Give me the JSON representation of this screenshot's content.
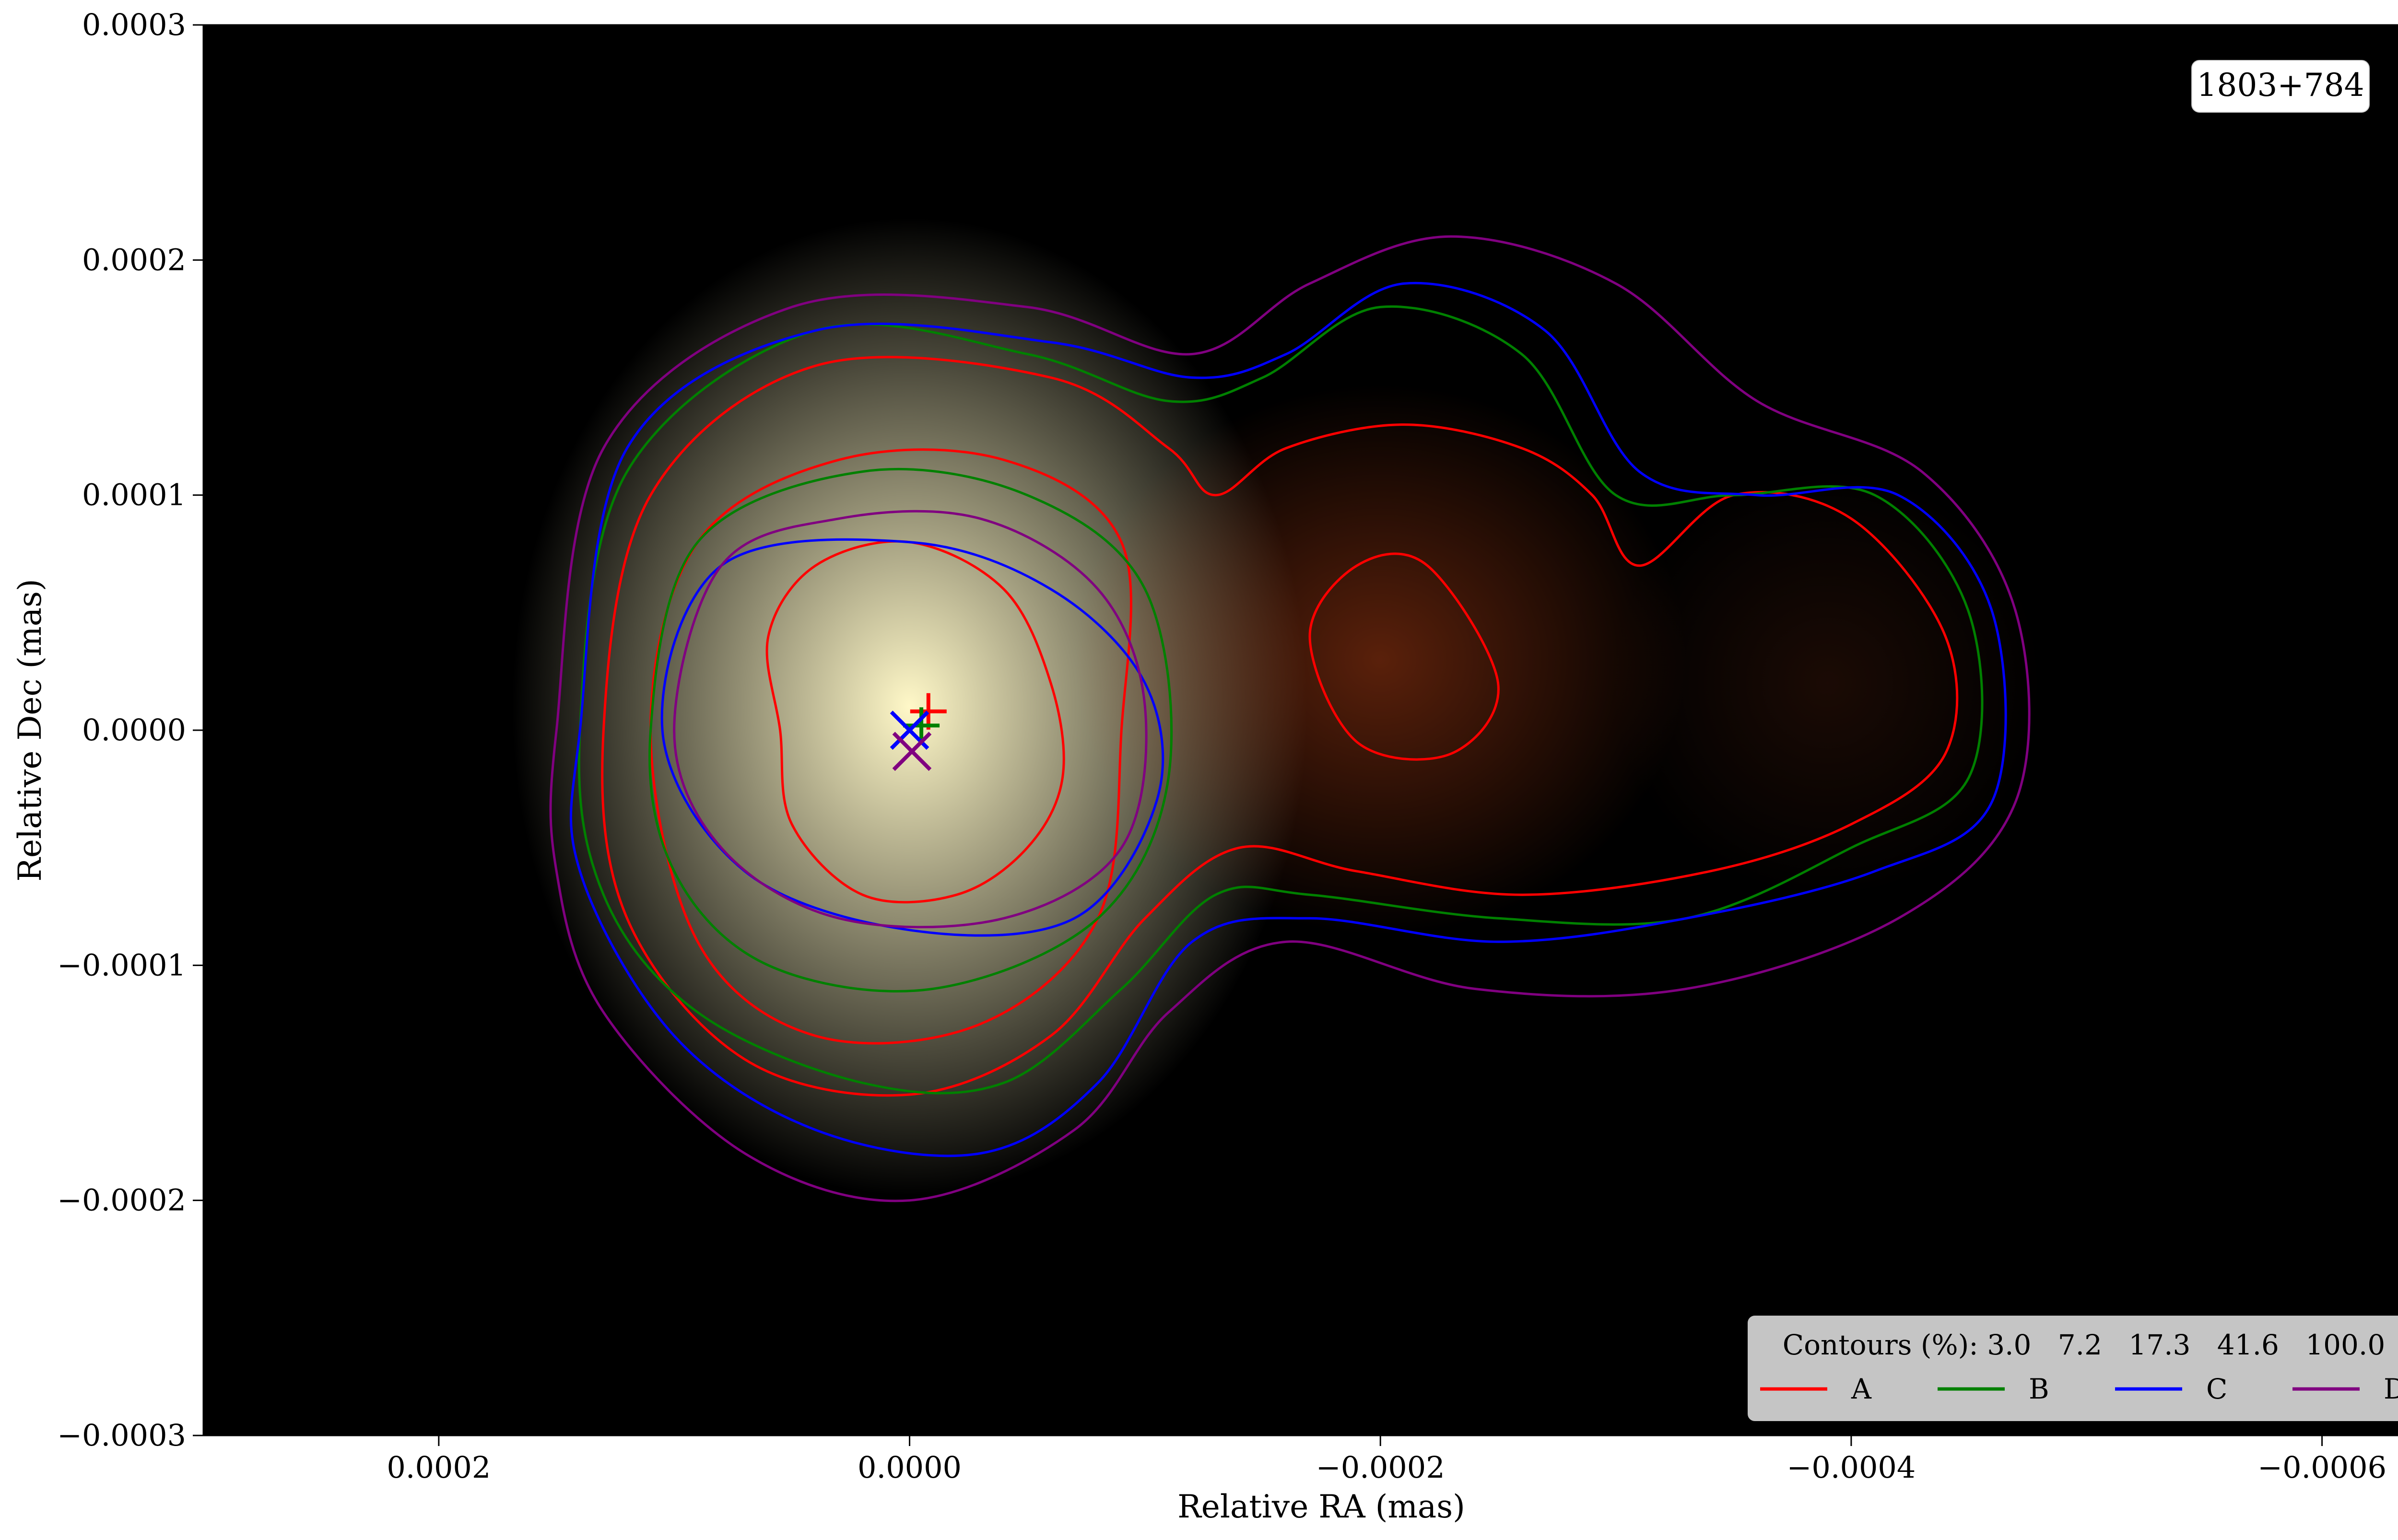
{
  "chart_data": {
    "type": "contour",
    "annotation": "1803+784",
    "xlabel": "Relative RA (mas)",
    "ylabel": "Relative Dec (mas)",
    "xlim": [
      0.0003,
      -0.00065
    ],
    "ylim": [
      -0.0003,
      0.0003
    ],
    "x_direction": "inverted",
    "xticks": [
      {
        "value": 0.0002,
        "label": "0.0002"
      },
      {
        "value": 0.0,
        "label": "0.0000"
      },
      {
        "value": -0.0002,
        "label": "−0.0002"
      },
      {
        "value": -0.0004,
        "label": "−0.0004"
      },
      {
        "value": -0.0006,
        "label": "−0.0006"
      }
    ],
    "yticks": [
      {
        "value": 0.0003,
        "label": "0.0003"
      },
      {
        "value": 0.0002,
        "label": "0.0002"
      },
      {
        "value": 0.0001,
        "label": "0.0001"
      },
      {
        "value": 0.0,
        "label": "0.0000"
      },
      {
        "value": -0.0001,
        "label": "−0.0001"
      },
      {
        "value": -0.0002,
        "label": "−0.0002"
      },
      {
        "value": -0.0003,
        "label": "−0.0003"
      }
    ],
    "legend": {
      "title": "Contours (%): 3.0   7.2   17.3   41.6   100.0",
      "placement": "lower-right",
      "contour_levels_percent": [
        3.0,
        7.2,
        17.3,
        41.6,
        100.0
      ]
    },
    "background_image": {
      "description_of_components": "bright core near origin, fainter red blob near x=-0.0002, faint blob near x=-0.00039",
      "components": [
        {
          "x": 0.0,
          "y": 1e-05,
          "sigma_x": 6.5e-05,
          "sigma_y": 8e-05,
          "peak": 1.0,
          "color": "#fff8c8"
        },
        {
          "x": -0.0002,
          "y": 3e-05,
          "sigma_x": 5e-05,
          "sigma_y": 4.5e-05,
          "peak": 0.45,
          "color": "#c84818"
        },
        {
          "x": -0.00039,
          "y": 2e-05,
          "sigma_x": 3.5e-05,
          "sigma_y": 3.5e-05,
          "peak": 0.22,
          "color": "#7a3016"
        }
      ]
    },
    "series": [
      {
        "name": "A",
        "color": "#ff0000",
        "contours": [
          [
            [
              5.5e-05,
              0.0
            ],
            [
              6e-05,
              4e-05
            ],
            [
              4e-05,
              7e-05
            ],
            [
              0.0,
              8e-05
            ],
            [
              -4e-05,
              6e-05
            ],
            [
              -6e-05,
              2e-05
            ],
            [
              -6.5e-05,
              -2e-05
            ],
            [
              -5e-05,
              -5e-05
            ],
            [
              -2e-05,
              -7e-05
            ],
            [
              2e-05,
              -7e-05
            ],
            [
              5e-05,
              -4e-05
            ]
          ],
          [
            [
              0.00011,
              0.0
            ],
            [
              9e-05,
              8e-05
            ],
            [
              3e-05,
              0.000115
            ],
            [
              -4e-05,
              0.000115
            ],
            [
              -9e-05,
              8e-05
            ],
            [
              -9e-05,
              0.0
            ],
            [
              -8e-05,
              -8e-05
            ],
            [
              -3e-05,
              -0.000125
            ],
            [
              4e-05,
              -0.00013
            ],
            [
              9e-05,
              -9e-05
            ]
          ],
          [
            [
              0.00013,
              0.0
            ],
            [
              0.00011,
              0.0001
            ],
            [
              4e-05,
              0.000155
            ],
            [
              -6e-05,
              0.00015
            ],
            [
              -0.00011,
              0.00012
            ],
            [
              -0.00013,
              0.0001
            ],
            [
              -0.00016,
              0.00012
            ],
            [
              -0.00021,
              0.00013
            ],
            [
              -0.00026,
              0.00012
            ],
            [
              -0.00029,
              0.0001
            ],
            [
              -0.00031,
              7e-05
            ],
            [
              -0.00035,
              0.0001
            ],
            [
              -0.0004,
              9e-05
            ],
            [
              -0.00044,
              4e-05
            ],
            [
              -0.00044,
              -1e-05
            ],
            [
              -0.0004,
              -4e-05
            ],
            [
              -0.00034,
              -6e-05
            ],
            [
              -0.00026,
              -7e-05
            ],
            [
              -0.00019,
              -6e-05
            ],
            [
              -0.00014,
              -5e-05
            ],
            [
              -0.0001,
              -8e-05
            ],
            [
              -6e-05,
              -0.00013
            ],
            [
              0.0,
              -0.000155
            ],
            [
              7e-05,
              -0.00014
            ],
            [
              0.00012,
              -8e-05
            ]
          ],
          [
            [
              -0.00017,
              4e-05
            ],
            [
              -0.00019,
              7e-05
            ],
            [
              -0.00022,
              7e-05
            ],
            [
              -0.00025,
              2e-05
            ],
            [
              -0.00023,
              -1e-05
            ],
            [
              -0.00019,
              -5e-06
            ]
          ]
        ]
      },
      {
        "name": "B",
        "color": "#008000",
        "contours": [
          [
            [
              0.00011,
              0.0
            ],
            [
              9e-05,
              8e-05
            ],
            [
              2e-05,
              0.00011
            ],
            [
              -5e-05,
              0.0001
            ],
            [
              -0.0001,
              6e-05
            ],
            [
              -0.00011,
              -2e-05
            ],
            [
              -8e-05,
              -8e-05
            ],
            [
              -1e-05,
              -0.00011
            ],
            [
              6e-05,
              -0.0001
            ],
            [
              0.0001,
              -6e-05
            ]
          ],
          [
            [
              0.00014,
              0.0
            ],
            [
              0.00012,
              0.00011
            ],
            [
              4e-05,
              0.00017
            ],
            [
              -5e-05,
              0.00016
            ],
            [
              -0.00011,
              0.00014
            ],
            [
              -0.00015,
              0.00015
            ],
            [
              -0.0002,
              0.00018
            ],
            [
              -0.00026,
              0.00016
            ],
            [
              -0.0003,
              0.0001
            ],
            [
              -0.00035,
              0.0001
            ],
            [
              -0.00041,
              0.0001
            ],
            [
              -0.00045,
              5e-05
            ],
            [
              -0.00045,
              -2e-05
            ],
            [
              -0.0004,
              -5e-05
            ],
            [
              -0.00033,
              -8e-05
            ],
            [
              -0.00025,
              -8e-05
            ],
            [
              -0.00017,
              -7e-05
            ],
            [
              -0.00013,
              -7e-05
            ],
            [
              -9e-05,
              -0.00011
            ],
            [
              -4e-05,
              -0.00015
            ],
            [
              2e-05,
              -0.00015
            ],
            [
              9e-05,
              -0.00012
            ],
            [
              0.00013,
              -7e-05
            ]
          ]
        ]
      },
      {
        "name": "C",
        "color": "#0000ff",
        "contours": [
          [
            [
              0.000105,
              0.0
            ],
            [
              8e-05,
              7e-05
            ],
            [
              0.0,
              8e-05
            ],
            [
              -6e-05,
              6e-05
            ],
            [
              -0.0001,
              2e-05
            ],
            [
              -0.000105,
              -3e-05
            ],
            [
              -7e-05,
              -8e-05
            ],
            [
              0.0,
              -8.5e-05
            ],
            [
              7e-05,
              -6e-05
            ]
          ],
          [
            [
              0.00014,
              0.0
            ],
            [
              0.00012,
              0.00012
            ],
            [
              4e-05,
              0.00017
            ],
            [
              -6e-05,
              0.000165
            ],
            [
              -0.00012,
              0.00015
            ],
            [
              -0.00016,
              0.00016
            ],
            [
              -0.00021,
              0.00019
            ],
            [
              -0.00027,
              0.00017
            ],
            [
              -0.00031,
              0.00011
            ],
            [
              -0.00036,
              0.0001
            ],
            [
              -0.00042,
              0.0001
            ],
            [
              -0.00046,
              5e-05
            ],
            [
              -0.00046,
              -3e-05
            ],
            [
              -0.00041,
              -6e-05
            ],
            [
              -0.00033,
              -8e-05
            ],
            [
              -0.00025,
              -9e-05
            ],
            [
              -0.00017,
              -8e-05
            ],
            [
              -0.00012,
              -9e-05
            ],
            [
              -8e-05,
              -0.00015
            ],
            [
              -3e-05,
              -0.00018
            ],
            [
              4e-05,
              -0.00017
            ],
            [
              0.0001,
              -0.00013
            ],
            [
              0.00014,
              -6e-05
            ]
          ]
        ]
      },
      {
        "name": "D",
        "color": "#800080",
        "contours": [
          [
            [
              0.0001,
              0.0
            ],
            [
              8e-05,
              7e-05
            ],
            [
              3e-05,
              9e-05
            ],
            [
              -3e-05,
              9e-05
            ],
            [
              -8e-05,
              6e-05
            ],
            [
              -0.0001,
              1e-05
            ],
            [
              -9e-05,
              -5e-05
            ],
            [
              -4e-05,
              -8e-05
            ],
            [
              3e-05,
              -8e-05
            ],
            [
              8e-05,
              -5e-05
            ]
          ],
          [
            [
              0.00015,
              0.0
            ],
            [
              0.00013,
              0.00012
            ],
            [
              5e-05,
              0.00018
            ],
            [
              -5e-05,
              0.00018
            ],
            [
              -0.00012,
              0.00016
            ],
            [
              -0.00017,
              0.00019
            ],
            [
              -0.00023,
              0.00021
            ],
            [
              -0.0003,
              0.00019
            ],
            [
              -0.00036,
              0.00014
            ],
            [
              -0.00043,
              0.00011
            ],
            [
              -0.00047,
              5e-05
            ],
            [
              -0.00047,
              -3e-05
            ],
            [
              -0.00042,
              -8e-05
            ],
            [
              -0.00033,
              -0.00011
            ],
            [
              -0.00024,
              -0.00011
            ],
            [
              -0.00016,
              -9e-05
            ],
            [
              -0.00011,
              -0.00012
            ],
            [
              -7e-05,
              -0.00017
            ],
            [
              0.0,
              -0.0002
            ],
            [
              7e-05,
              -0.00018
            ],
            [
              0.00013,
              -0.00012
            ],
            [
              0.00015,
              -6e-05
            ]
          ]
        ]
      }
    ],
    "component_markers": [
      {
        "name": "A",
        "color": "#ff0000",
        "shape": "plus",
        "x": -8e-06,
        "y": 8e-06
      },
      {
        "name": "B",
        "color": "#008000",
        "shape": "plus",
        "x": -5e-06,
        "y": 2e-06
      },
      {
        "name": "C",
        "color": "#0000ff",
        "shape": "x",
        "x": 0.0,
        "y": 0.0
      },
      {
        "name": "D",
        "color": "#800080",
        "shape": "x",
        "x": -1e-06,
        "y": -9e-06
      }
    ]
  }
}
